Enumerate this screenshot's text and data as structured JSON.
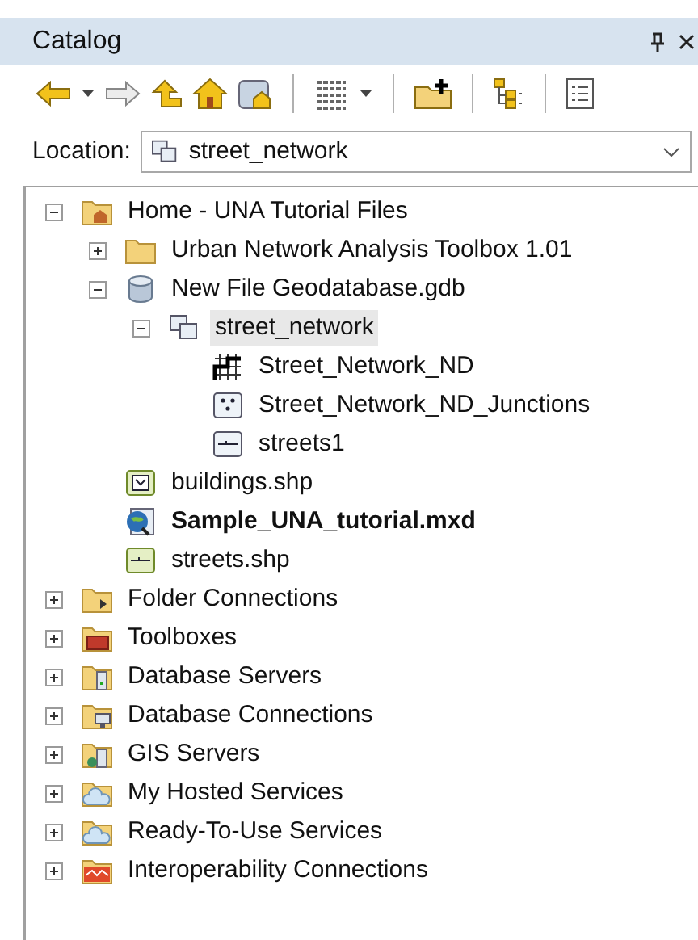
{
  "panel": {
    "title": "Catalog"
  },
  "location": {
    "label": "Location:",
    "value": "street_network"
  },
  "tree": [
    {
      "label": "Home - UNA Tutorial Files",
      "kind": "home_folder",
      "expanded": true,
      "selected": false,
      "bold": false,
      "children": [
        {
          "label": "Urban Network Analysis Toolbox 1.01",
          "kind": "folder",
          "expanded": false,
          "selected": false,
          "bold": false
        },
        {
          "label": "New File Geodatabase.gdb",
          "kind": "geodatabase",
          "expanded": true,
          "selected": false,
          "bold": false,
          "children": [
            {
              "label": "street_network",
              "kind": "feature_dataset",
              "expanded": true,
              "selected": true,
              "bold": false,
              "children": [
                {
                  "label": "Street_Network_ND",
                  "kind": "network_dataset",
                  "selected": false,
                  "bold": false
                },
                {
                  "label": "Street_Network_ND_Junctions",
                  "kind": "point_class",
                  "selected": false,
                  "bold": false
                },
                {
                  "label": "streets1",
                  "kind": "line_class",
                  "selected": false,
                  "bold": false
                }
              ]
            }
          ]
        },
        {
          "label": "buildings.shp",
          "kind": "polygon_shapefile",
          "selected": false,
          "bold": false
        },
        {
          "label": "Sample_UNA_tutorial.mxd",
          "kind": "map_document",
          "selected": false,
          "bold": true
        },
        {
          "label": "streets.shp",
          "kind": "line_shapefile",
          "selected": false,
          "bold": false
        }
      ]
    },
    {
      "label": "Folder Connections",
      "kind": "folder_connections",
      "expanded": false,
      "selected": false,
      "bold": false
    },
    {
      "label": "Toolboxes",
      "kind": "toolboxes",
      "expanded": false,
      "selected": false,
      "bold": false
    },
    {
      "label": "Database Servers",
      "kind": "database_servers",
      "expanded": false,
      "selected": false,
      "bold": false
    },
    {
      "label": "Database Connections",
      "kind": "database_connections",
      "expanded": false,
      "selected": false,
      "bold": false
    },
    {
      "label": "GIS Servers",
      "kind": "gis_servers",
      "expanded": false,
      "selected": false,
      "bold": false
    },
    {
      "label": "My Hosted Services",
      "kind": "hosted_services",
      "expanded": false,
      "selected": false,
      "bold": false
    },
    {
      "label": "Ready-To-Use Services",
      "kind": "ready_services",
      "expanded": false,
      "selected": false,
      "bold": false
    },
    {
      "label": "Interoperability Connections",
      "kind": "interoperability",
      "expanded": false,
      "selected": false,
      "bold": false
    }
  ]
}
